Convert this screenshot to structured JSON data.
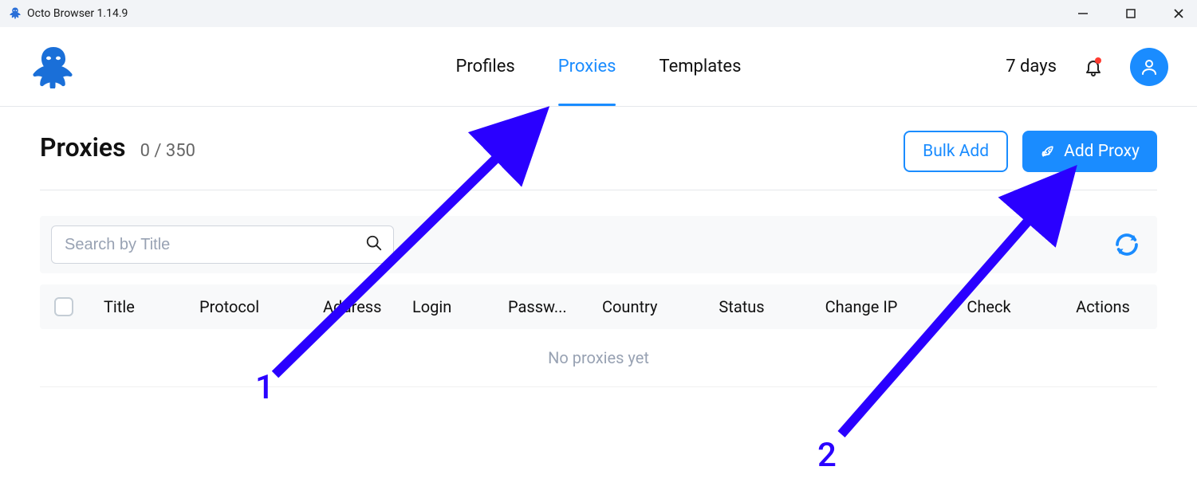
{
  "window": {
    "title": "Octo Browser 1.14.9"
  },
  "nav": {
    "tabs": [
      {
        "label": "Profiles",
        "active": false
      },
      {
        "label": "Proxies",
        "active": true
      },
      {
        "label": "Templates",
        "active": false
      }
    ],
    "days": "7 days"
  },
  "page": {
    "title": "Proxies",
    "count": "0 / 350",
    "bulk_add": "Bulk Add",
    "add_proxy": "Add Proxy"
  },
  "search": {
    "placeholder": "Search by Title"
  },
  "table": {
    "headers": {
      "title": "Title",
      "protocol": "Protocol",
      "address": "Address",
      "login": "Login",
      "password": "Passw...",
      "country": "Country",
      "status": "Status",
      "change_ip": "Change IP",
      "check": "Check",
      "actions": "Actions"
    },
    "empty": "No proxies yet"
  },
  "annotations": {
    "one": "1",
    "two": "2"
  }
}
